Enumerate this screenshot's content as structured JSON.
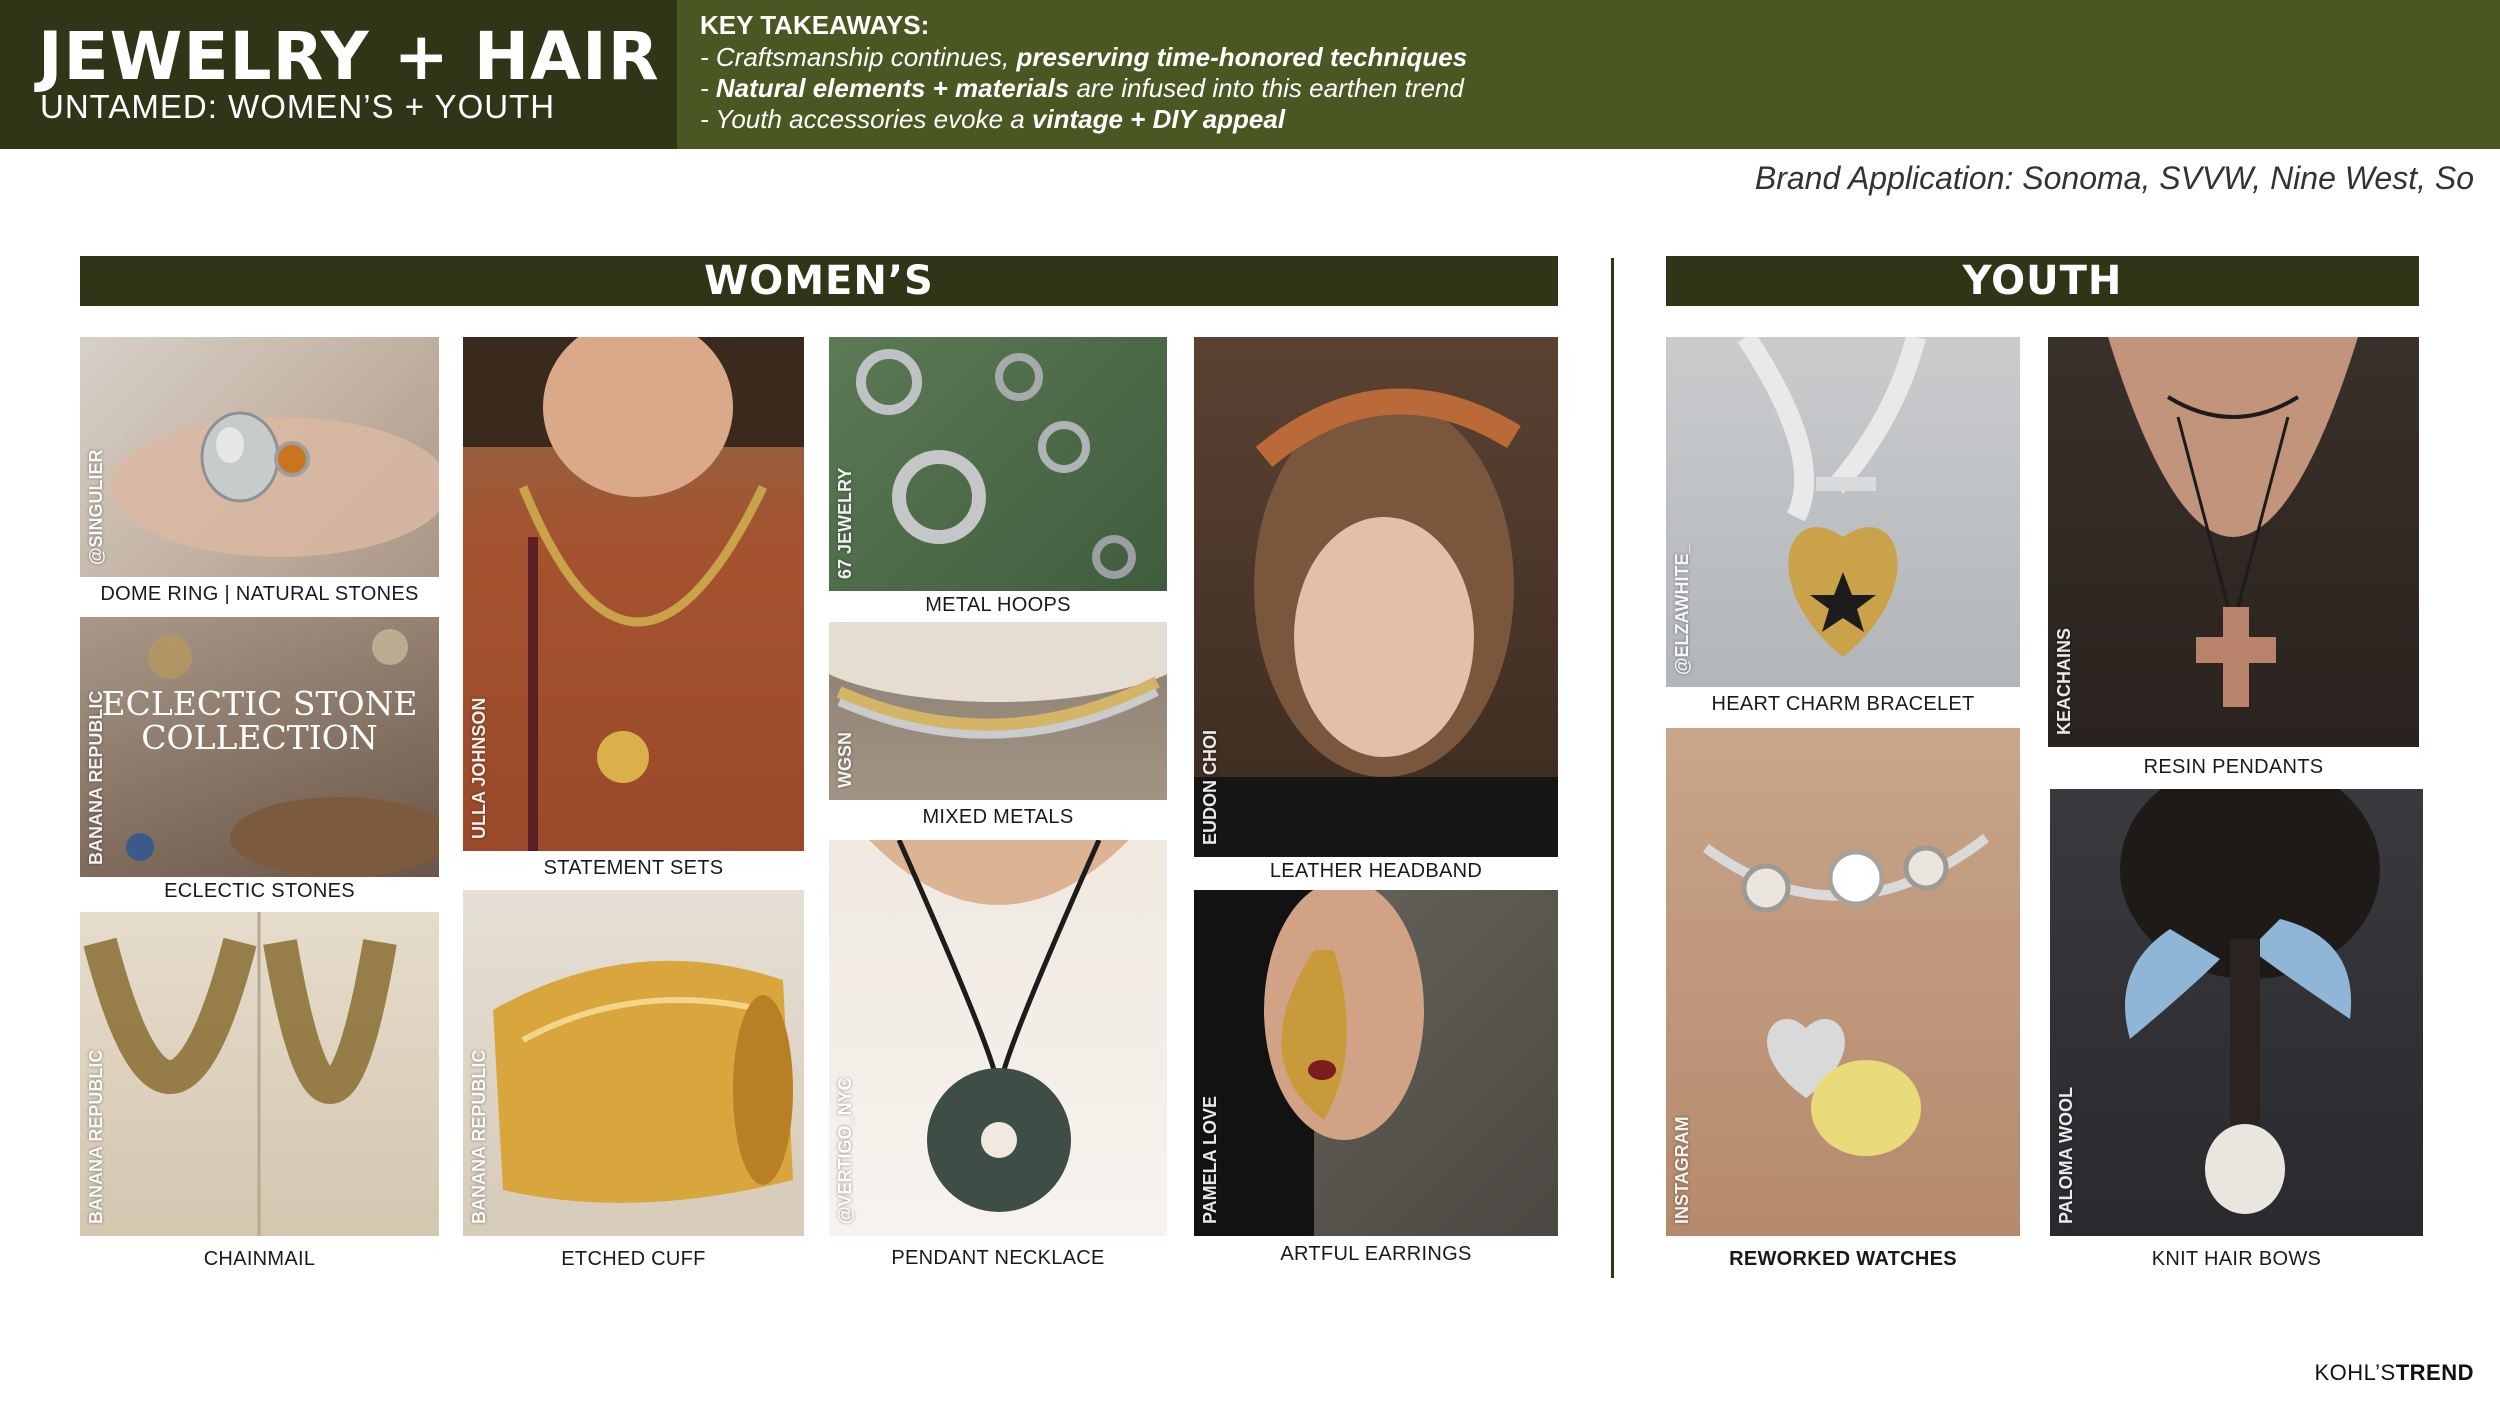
{
  "header": {
    "title": "JEWELRY + HAIR",
    "subtitle": "UNTAMED: WOMEN’S + YOUTH",
    "takeaways_heading": "KEY TAKEAWAYS:",
    "takeaways": [
      {
        "pre": "- Craftsmanship continues, ",
        "bold": "preserving time-honored techniques",
        "post": ""
      },
      {
        "pre": "- ",
        "bold": "Natural elements + materials",
        "post": " are infused into this earthen trend"
      },
      {
        "pre": "- Youth accessories evoke a ",
        "bold": "vintage + DIY appeal",
        "post": ""
      }
    ]
  },
  "brand_application": "Brand Application: Sonoma, SVVW, Nine West, So",
  "sections": {
    "womens": "WOMEN’S",
    "youth": "YOUTH"
  },
  "womens_tiles": [
    {
      "credit": "@SINGULIER",
      "caption": "DOME RING  |  NATURAL STONES"
    },
    {
      "credit": "BANANA REPUBLIC",
      "caption": "ECLECTIC STONES",
      "overlay_title_1": "ECLECTIC STONE",
      "overlay_title_2": "COLLECTION"
    },
    {
      "credit": "BANANA REPUBLIC",
      "caption": "CHAINMAIL"
    },
    {
      "credit": "ULLA JOHNSON",
      "caption": "STATEMENT SETS"
    },
    {
      "credit": "BANANA REPUBLIC",
      "caption": "ETCHED CUFF"
    },
    {
      "credit": "67 JEWELRY",
      "caption": "METAL HOOPS"
    },
    {
      "credit": "WGSN",
      "caption": "MIXED METALS"
    },
    {
      "credit": "@VERTIGO_NYC",
      "caption": "PENDANT NECKLACE"
    },
    {
      "credit": "EUDON CHOI",
      "caption": "LEATHER HEADBAND"
    },
    {
      "credit": "PAMELA LOVE",
      "caption": "ARTFUL EARRINGS"
    }
  ],
  "youth_tiles": [
    {
      "credit": "@ELZAWHITE_",
      "caption": "HEART CHARM BRACELET"
    },
    {
      "credit": "INSTAGRAM",
      "caption": "REWORKED WATCHES"
    },
    {
      "credit": "KEACHAINS",
      "caption": "RESIN PENDANTS"
    },
    {
      "credit": "PALOMA WOOL",
      "caption": "KNIT HAIR BOWS"
    }
  ],
  "footer": {
    "logo_main": "KOHL’S",
    "logo_bold": "TREND"
  },
  "colors": {
    "dark_olive": "#2e3617",
    "olive": "#4b5722",
    "white": "#ffffff"
  }
}
